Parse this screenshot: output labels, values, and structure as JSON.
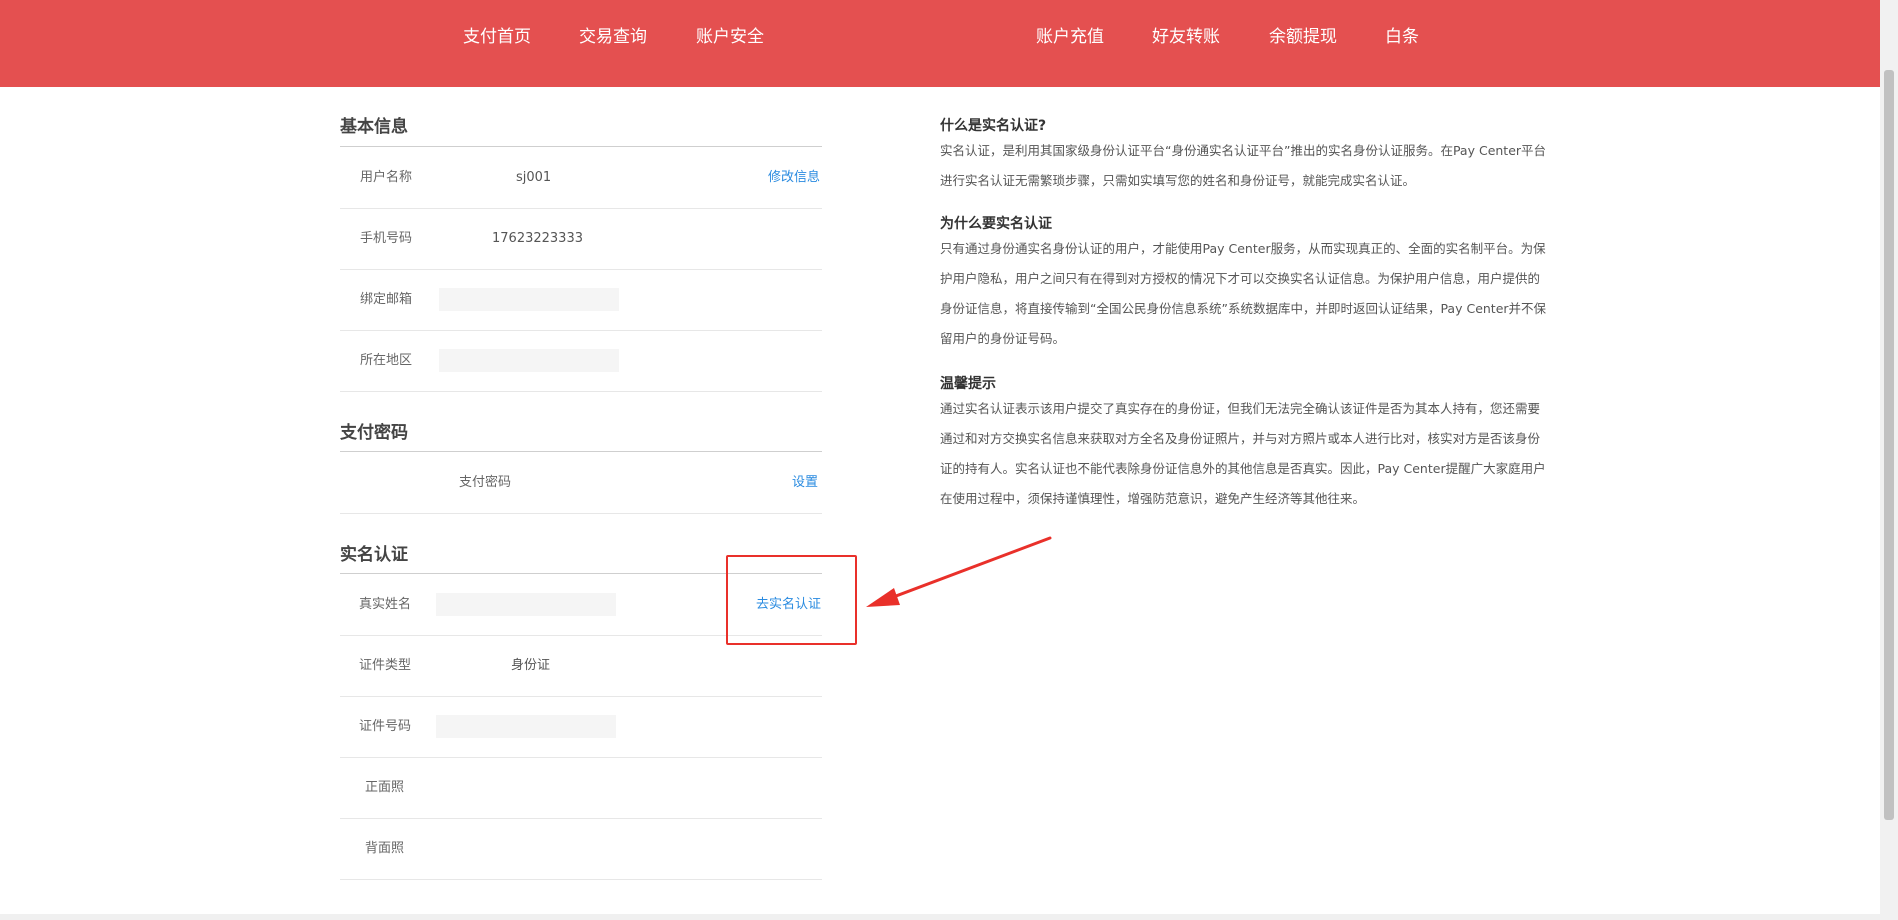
{
  "nav": {
    "left": [
      "支付首页",
      "交易查询",
      "账户安全"
    ],
    "right": [
      "账户充值",
      "好友转账",
      "余额提现",
      "白条"
    ]
  },
  "basic_info": {
    "title": "基本信息",
    "username_label": "用户名称",
    "username_value": "sj001",
    "edit_link": "修改信息",
    "phone_label": "手机号码",
    "phone_value": "17623223333",
    "email_label": "绑定邮箱",
    "region_label": "所在地区"
  },
  "pay_password": {
    "title": "支付密码",
    "label": "支付密码",
    "set_link": "设置"
  },
  "realname": {
    "title": "实名认证",
    "real_name_label": "真实姓名",
    "verify_link": "去实名认证",
    "id_type_label": "证件类型",
    "id_type_value": "身份证",
    "id_number_label": "证件号码",
    "front_label": "正面照",
    "back_label": "背面照"
  },
  "info": {
    "q1_title": "什么是实名认证?",
    "q1_text": "实名认证，是利用其国家级身份认证平台“身份通实名认证平台”推出的实名身份认证服务。在Pay Center平台进行实名认证无需繁琐步骤，只需如实填写您的姓名和身份证号，就能完成实名认证。",
    "q2_title": "为什么要实名认证",
    "q2_text": "只有通过身份通实名身份认证的用户，才能使用Pay Center服务，从而实现真正的、全面的实名制平台。为保护用户隐私，用户之间只有在得到对方授权的情况下才可以交换实名认证信息。为保护用户信息，用户提供的身份证信息，将直接传输到“全国公民身份信息系统”系统数据库中，并即时返回认证结果，Pay Center并不保留用户的身份证号码。",
    "q3_title": "温馨提示",
    "q3_text": "通过实名认证表示该用户提交了真实存在的身份证，但我们无法完全确认该证件是否为其本人持有，您还需要通过和对方交换实名信息来获取对方全名及身份证照片，并与对方照片或本人进行比对，核实对方是否该身份证的持有人。实名认证也不能代表除身份证信息外的其他信息是否真实。因此，Pay Center提醒广大家庭用户在使用过程中，须保持谨慎理性，增强防范意识，避免产生经济等其他往来。"
  },
  "colors": {
    "nav_bg": "#e45050",
    "link": "#2a8be0",
    "annotation": "#e9302a"
  }
}
